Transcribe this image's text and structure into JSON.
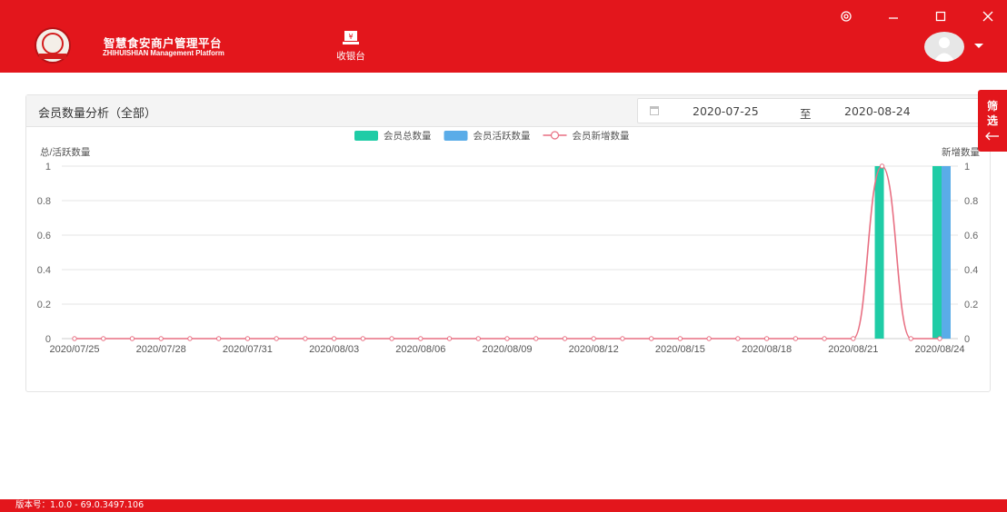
{
  "header": {
    "brand_title": "智慧食安商户管理平台",
    "brand_subtitle": "ZHIHUISHIAN Management Platform",
    "cashier_label": "收银台",
    "brand_color": "#e3161c"
  },
  "window_controls": [
    "settings-icon",
    "minimize-icon",
    "maximize-icon",
    "close-icon"
  ],
  "panel": {
    "title": "会员数量分析（全部）",
    "date_start": "2020-07-25",
    "date_separator": "至",
    "date_end": "2020-08-24"
  },
  "filter_tab": {
    "line1": "筛",
    "line2": "选",
    "icon": "arrow-left-icon"
  },
  "chart_data": {
    "type": "bar",
    "legend": [
      {
        "name": "会员总数量",
        "type": "bar",
        "color": "#1fcca6"
      },
      {
        "name": "会员活跃数量",
        "type": "bar",
        "color": "#5aace8"
      },
      {
        "name": "会员新增数量",
        "type": "line",
        "color": "#e86f82"
      }
    ],
    "legend_position": "top-center",
    "ylabel_left": "总/活跃数量",
    "ylabel_right": "新增数量",
    "yticks": [
      "0",
      "0.2",
      "0.4",
      "0.6",
      "0.8",
      "1"
    ],
    "ylim": [
      0,
      1
    ],
    "x_tick_labels": [
      "2020/07/25",
      "2020/07/28",
      "2020/07/31",
      "2020/08/03",
      "2020/08/06",
      "2020/08/09",
      "2020/08/12",
      "2020/08/15",
      "2020/08/18",
      "2020/08/21",
      "2020/08/24"
    ],
    "categories": [
      "2020/07/25",
      "2020/07/26",
      "2020/07/27",
      "2020/07/28",
      "2020/07/29",
      "2020/07/30",
      "2020/07/31",
      "2020/08/01",
      "2020/08/02",
      "2020/08/03",
      "2020/08/04",
      "2020/08/05",
      "2020/08/06",
      "2020/08/07",
      "2020/08/08",
      "2020/08/09",
      "2020/08/10",
      "2020/08/11",
      "2020/08/12",
      "2020/08/13",
      "2020/08/14",
      "2020/08/15",
      "2020/08/16",
      "2020/08/17",
      "2020/08/18",
      "2020/08/19",
      "2020/08/20",
      "2020/08/21",
      "2020/08/22",
      "2020/08/23",
      "2020/08/24"
    ],
    "series": [
      {
        "name": "会员总数量",
        "values": [
          0,
          0,
          0,
          0,
          0,
          0,
          0,
          0,
          0,
          0,
          0,
          0,
          0,
          0,
          0,
          0,
          0,
          0,
          0,
          0,
          0,
          0,
          0,
          0,
          0,
          0,
          0,
          0,
          1,
          0,
          1
        ]
      },
      {
        "name": "会员活跃数量",
        "values": [
          0,
          0,
          0,
          0,
          0,
          0,
          0,
          0,
          0,
          0,
          0,
          0,
          0,
          0,
          0,
          0,
          0,
          0,
          0,
          0,
          0,
          0,
          0,
          0,
          0,
          0,
          0,
          0,
          0,
          0,
          1
        ]
      },
      {
        "name": "会员新增数量",
        "values": [
          0,
          0,
          0,
          0,
          0,
          0,
          0,
          0,
          0,
          0,
          0,
          0,
          0,
          0,
          0,
          0,
          0,
          0,
          0,
          0,
          0,
          0,
          0,
          0,
          0,
          0,
          0,
          0,
          1,
          0,
          0
        ]
      }
    ],
    "grid": true,
    "smooth": true
  },
  "footer": {
    "version": "版本号：1.0.0 - 69.0.3497.106"
  }
}
